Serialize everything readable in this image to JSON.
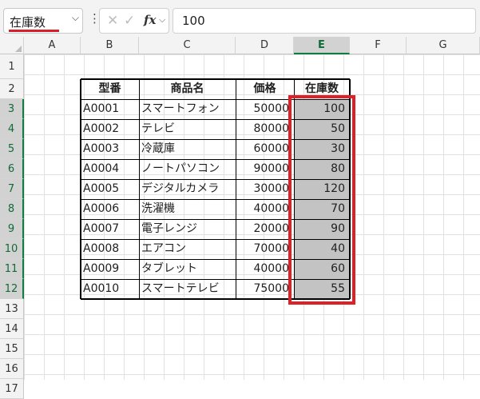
{
  "formula_bar": {
    "name_box": "在庫数",
    "more_icon": "more-vertical-icon",
    "cancel_icon": "x-icon",
    "enter_icon": "check-icon",
    "fx_label": "fx",
    "formula_value": "100"
  },
  "columns": [
    "A",
    "B",
    "C",
    "D",
    "E",
    "F",
    "G"
  ],
  "rows": [
    "1",
    "2",
    "3",
    "4",
    "5",
    "6",
    "7",
    "8",
    "9",
    "10",
    "11",
    "12",
    "13",
    "14",
    "15",
    "16",
    "17"
  ],
  "table": {
    "headers": [
      "型番",
      "商品名",
      "価格",
      "在庫数"
    ],
    "rows": [
      [
        "A0001",
        "スマートフォン",
        "50000",
        "100"
      ],
      [
        "A0002",
        "テレビ",
        "80000",
        "50"
      ],
      [
        "A0003",
        "冷蔵庫",
        "60000",
        "30"
      ],
      [
        "A0004",
        "ノートパソコン",
        "90000",
        "80"
      ],
      [
        "A0005",
        "デジタルカメラ",
        "30000",
        "120"
      ],
      [
        "A0006",
        "洗濯機",
        "40000",
        "70"
      ],
      [
        "A0007",
        "電子レンジ",
        "20000",
        "90"
      ],
      [
        "A0008",
        "エアコン",
        "70000",
        "40"
      ],
      [
        "A0009",
        "タブレット",
        "40000",
        "60"
      ],
      [
        "A0010",
        "スマートテレビ",
        "75000",
        "55"
      ]
    ]
  },
  "colors": {
    "highlight_box": "#e01f26",
    "selection_fill": "#c3c3c3",
    "selection_accent": "#107c41"
  }
}
